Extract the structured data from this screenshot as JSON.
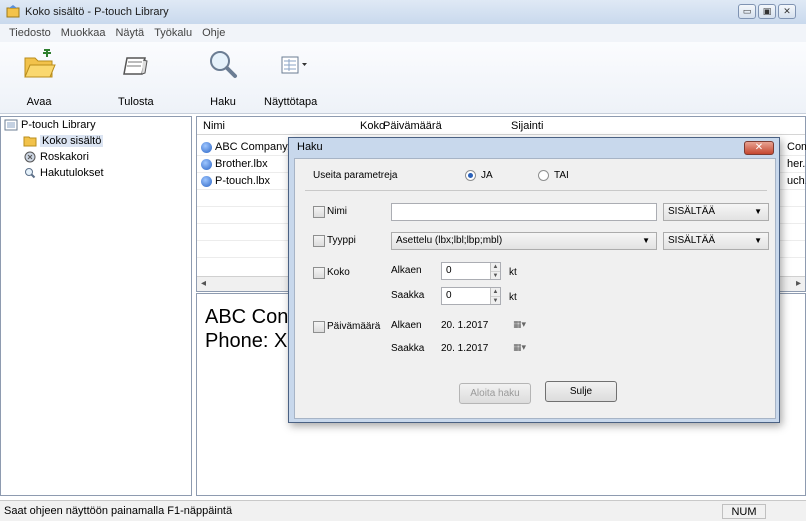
{
  "window": {
    "title": "Koko sisältö - P-touch Library",
    "buttons": [
      "▭",
      "▣",
      "✕"
    ]
  },
  "menu": [
    "Tiedosto",
    "Muokkaa",
    "Näytä",
    "Työkalu",
    "Ohje"
  ],
  "toolbar": {
    "open": "Avaa",
    "print": "Tulosta",
    "search": "Haku",
    "view": "Näyttötapa"
  },
  "tree": {
    "root": "P-touch Library",
    "all": "Koko sisältö",
    "trash": "Roskakori",
    "results": "Hakutulokset"
  },
  "list": {
    "headers": {
      "name": "Nimi",
      "size": "Koko",
      "date": "Päivämäärä",
      "location": "Sijainti"
    },
    "rows": [
      {
        "name": "ABC Company.lb",
        "right": "Comp"
      },
      {
        "name": "Brother.lbx",
        "right": "her.lbx"
      },
      {
        "name": "P-touch.lbx",
        "right": "uch.lb"
      }
    ]
  },
  "preview": {
    "line1": "ABC Con",
    "line2": "Phone: X"
  },
  "status": {
    "message": "Saat ohjeen näyttöön painamalla F1-näppäintä",
    "num": "NUM"
  },
  "dialog": {
    "title": "Haku",
    "close": "✕",
    "multi_label": "Useita parametreja",
    "and_label": "JA",
    "or_label": "TAI",
    "name_label": "Nimi",
    "name_value": "",
    "name_mode": "SISÄLTÄÄ",
    "type_label": "Tyyppi",
    "type_value": "Asettelu (lbx;lbl;lbp;mbl)",
    "type_mode": "SISÄLTÄÄ",
    "size_label": "Koko",
    "from_label": "Alkaen",
    "to_label": "Saakka",
    "size_from": "0",
    "size_to": "0",
    "unit": "kt",
    "date_label": "Päivämäärä",
    "date_from": "20. 1.2017",
    "date_to": "20. 1.2017",
    "start_button": "Aloita haku",
    "close_button": "Sulje"
  }
}
